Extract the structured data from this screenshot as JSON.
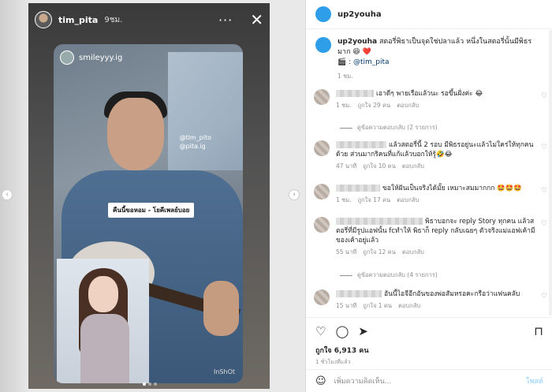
{
  "story": {
    "username": "tim_pita",
    "time": "9ชม.",
    "more_icon": "more-dots-icon",
    "close_icon": "close-icon",
    "card_username": "smileyyy.ig",
    "mentions": [
      "@tim_pito",
      "@pita.ig"
    ],
    "sticker_text": "คืนนี้ขอหอม - โยคีเพลย์บอย",
    "watermark": "InShOt"
  },
  "post": {
    "username": "up2youha",
    "caption_user": "up2youha",
    "caption_text": "สตอรี่พิธาเป็นจุดใช่ปลาแล้ว หนึ่งในสตอรี่นั้นมีพิธรมาก 😆 ❤️",
    "caption_mention_prefix": "🎬 :",
    "caption_mention": "@tim_pita",
    "caption_time": "1 ชม.",
    "comments": [
      {
        "text": "เอาดีๆ พายเรือแล้วนะ รอขึ้นฝั่งค่ะ 😂",
        "time": "1 ชม.",
        "likes": "ถูกใจ 29 คน",
        "reply": "ตอบกลับ"
      },
      {
        "text": "แล้วสตอรี่นี้ 2 รอบ มีพิธรอยู่นะแล้วไม่ใคร่ให้ทุกคนด้วย ส่วนมากริคนที่แก้แล้วบอกให้รู้🤣😂",
        "time": "47 นาที",
        "likes": "ถูกใจ 10 คน",
        "reply": "ตอบกลับ"
      },
      {
        "text": "ขอให้ฝันเป็นจริงได้มั้ย เหมาะสมมากกก 🤩🤩🤩",
        "time": "1 ชม.",
        "likes": "ถูกใจ 17 คน",
        "reply": "ตอบกลับ"
      },
      {
        "text": "พิธาบอกจะ reply Story ทุกคน แล้วสตอรี่ที่มีรูปแอฟนั้น fcทำให้ พิธาก็ reply กลับเฉยๆ ตัวจริงแม่แอฟเค้ามีของเค้าอยู่แล้ว",
        "time": "55 นาที",
        "likes": "ถูกใจ 12 คน",
        "reply": "ตอบกลับ"
      },
      {
        "text": "อันนี้ไอจีอีกอันของพ่อสัมหรอคะกรือว่าแฟนคลับ",
        "time": "15 นาที",
        "likes": "ถูกใจ 1 คน",
        "reply": "ตอบกลับ"
      }
    ],
    "view_replies_1": "ดูข้อความตอบกลับ (2 รายการ)",
    "view_replies_2": "ดูข้อความตอบกลับ (4 รายการ)",
    "likes_total": "ถูกใจ 6,913 คน",
    "posted_ago": "1 ชั่วโมงที่แล้ว",
    "add_comment_placeholder": "เพิ่มความคิดเห็น...",
    "post_button": "โพสต์"
  }
}
